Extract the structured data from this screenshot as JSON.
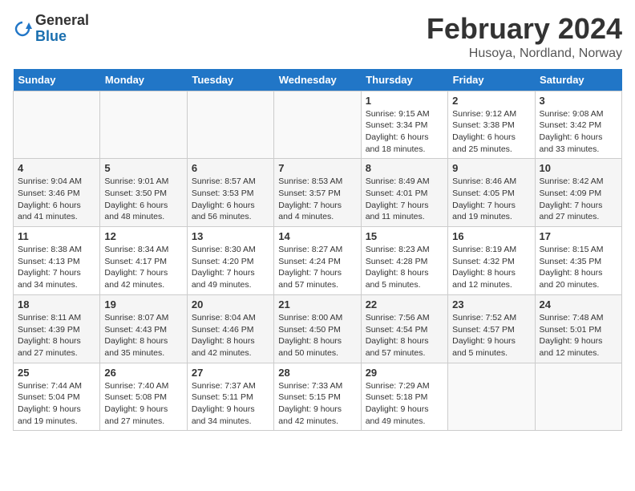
{
  "header": {
    "logo_general": "General",
    "logo_blue": "Blue",
    "month_title": "February 2024",
    "location": "Husoya, Nordland, Norway"
  },
  "weekdays": [
    "Sunday",
    "Monday",
    "Tuesday",
    "Wednesday",
    "Thursday",
    "Friday",
    "Saturday"
  ],
  "weeks": [
    [
      {
        "day": "",
        "sunrise": "",
        "sunset": "",
        "daylight": ""
      },
      {
        "day": "",
        "sunrise": "",
        "sunset": "",
        "daylight": ""
      },
      {
        "day": "",
        "sunrise": "",
        "sunset": "",
        "daylight": ""
      },
      {
        "day": "",
        "sunrise": "",
        "sunset": "",
        "daylight": ""
      },
      {
        "day": "1",
        "sunrise": "Sunrise: 9:15 AM",
        "sunset": "Sunset: 3:34 PM",
        "daylight": "Daylight: 6 hours and 18 minutes."
      },
      {
        "day": "2",
        "sunrise": "Sunrise: 9:12 AM",
        "sunset": "Sunset: 3:38 PM",
        "daylight": "Daylight: 6 hours and 25 minutes."
      },
      {
        "day": "3",
        "sunrise": "Sunrise: 9:08 AM",
        "sunset": "Sunset: 3:42 PM",
        "daylight": "Daylight: 6 hours and 33 minutes."
      }
    ],
    [
      {
        "day": "4",
        "sunrise": "Sunrise: 9:04 AM",
        "sunset": "Sunset: 3:46 PM",
        "daylight": "Daylight: 6 hours and 41 minutes."
      },
      {
        "day": "5",
        "sunrise": "Sunrise: 9:01 AM",
        "sunset": "Sunset: 3:50 PM",
        "daylight": "Daylight: 6 hours and 48 minutes."
      },
      {
        "day": "6",
        "sunrise": "Sunrise: 8:57 AM",
        "sunset": "Sunset: 3:53 PM",
        "daylight": "Daylight: 6 hours and 56 minutes."
      },
      {
        "day": "7",
        "sunrise": "Sunrise: 8:53 AM",
        "sunset": "Sunset: 3:57 PM",
        "daylight": "Daylight: 7 hours and 4 minutes."
      },
      {
        "day": "8",
        "sunrise": "Sunrise: 8:49 AM",
        "sunset": "Sunset: 4:01 PM",
        "daylight": "Daylight: 7 hours and 11 minutes."
      },
      {
        "day": "9",
        "sunrise": "Sunrise: 8:46 AM",
        "sunset": "Sunset: 4:05 PM",
        "daylight": "Daylight: 7 hours and 19 minutes."
      },
      {
        "day": "10",
        "sunrise": "Sunrise: 8:42 AM",
        "sunset": "Sunset: 4:09 PM",
        "daylight": "Daylight: 7 hours and 27 minutes."
      }
    ],
    [
      {
        "day": "11",
        "sunrise": "Sunrise: 8:38 AM",
        "sunset": "Sunset: 4:13 PM",
        "daylight": "Daylight: 7 hours and 34 minutes."
      },
      {
        "day": "12",
        "sunrise": "Sunrise: 8:34 AM",
        "sunset": "Sunset: 4:17 PM",
        "daylight": "Daylight: 7 hours and 42 minutes."
      },
      {
        "day": "13",
        "sunrise": "Sunrise: 8:30 AM",
        "sunset": "Sunset: 4:20 PM",
        "daylight": "Daylight: 7 hours and 49 minutes."
      },
      {
        "day": "14",
        "sunrise": "Sunrise: 8:27 AM",
        "sunset": "Sunset: 4:24 PM",
        "daylight": "Daylight: 7 hours and 57 minutes."
      },
      {
        "day": "15",
        "sunrise": "Sunrise: 8:23 AM",
        "sunset": "Sunset: 4:28 PM",
        "daylight": "Daylight: 8 hours and 5 minutes."
      },
      {
        "day": "16",
        "sunrise": "Sunrise: 8:19 AM",
        "sunset": "Sunset: 4:32 PM",
        "daylight": "Daylight: 8 hours and 12 minutes."
      },
      {
        "day": "17",
        "sunrise": "Sunrise: 8:15 AM",
        "sunset": "Sunset: 4:35 PM",
        "daylight": "Daylight: 8 hours and 20 minutes."
      }
    ],
    [
      {
        "day": "18",
        "sunrise": "Sunrise: 8:11 AM",
        "sunset": "Sunset: 4:39 PM",
        "daylight": "Daylight: 8 hours and 27 minutes."
      },
      {
        "day": "19",
        "sunrise": "Sunrise: 8:07 AM",
        "sunset": "Sunset: 4:43 PM",
        "daylight": "Daylight: 8 hours and 35 minutes."
      },
      {
        "day": "20",
        "sunrise": "Sunrise: 8:04 AM",
        "sunset": "Sunset: 4:46 PM",
        "daylight": "Daylight: 8 hours and 42 minutes."
      },
      {
        "day": "21",
        "sunrise": "Sunrise: 8:00 AM",
        "sunset": "Sunset: 4:50 PM",
        "daylight": "Daylight: 8 hours and 50 minutes."
      },
      {
        "day": "22",
        "sunrise": "Sunrise: 7:56 AM",
        "sunset": "Sunset: 4:54 PM",
        "daylight": "Daylight: 8 hours and 57 minutes."
      },
      {
        "day": "23",
        "sunrise": "Sunrise: 7:52 AM",
        "sunset": "Sunset: 4:57 PM",
        "daylight": "Daylight: 9 hours and 5 minutes."
      },
      {
        "day": "24",
        "sunrise": "Sunrise: 7:48 AM",
        "sunset": "Sunset: 5:01 PM",
        "daylight": "Daylight: 9 hours and 12 minutes."
      }
    ],
    [
      {
        "day": "25",
        "sunrise": "Sunrise: 7:44 AM",
        "sunset": "Sunset: 5:04 PM",
        "daylight": "Daylight: 9 hours and 19 minutes."
      },
      {
        "day": "26",
        "sunrise": "Sunrise: 7:40 AM",
        "sunset": "Sunset: 5:08 PM",
        "daylight": "Daylight: 9 hours and 27 minutes."
      },
      {
        "day": "27",
        "sunrise": "Sunrise: 7:37 AM",
        "sunset": "Sunset: 5:11 PM",
        "daylight": "Daylight: 9 hours and 34 minutes."
      },
      {
        "day": "28",
        "sunrise": "Sunrise: 7:33 AM",
        "sunset": "Sunset: 5:15 PM",
        "daylight": "Daylight: 9 hours and 42 minutes."
      },
      {
        "day": "29",
        "sunrise": "Sunrise: 7:29 AM",
        "sunset": "Sunset: 5:18 PM",
        "daylight": "Daylight: 9 hours and 49 minutes."
      },
      {
        "day": "",
        "sunrise": "",
        "sunset": "",
        "daylight": ""
      },
      {
        "day": "",
        "sunrise": "",
        "sunset": "",
        "daylight": ""
      }
    ]
  ]
}
